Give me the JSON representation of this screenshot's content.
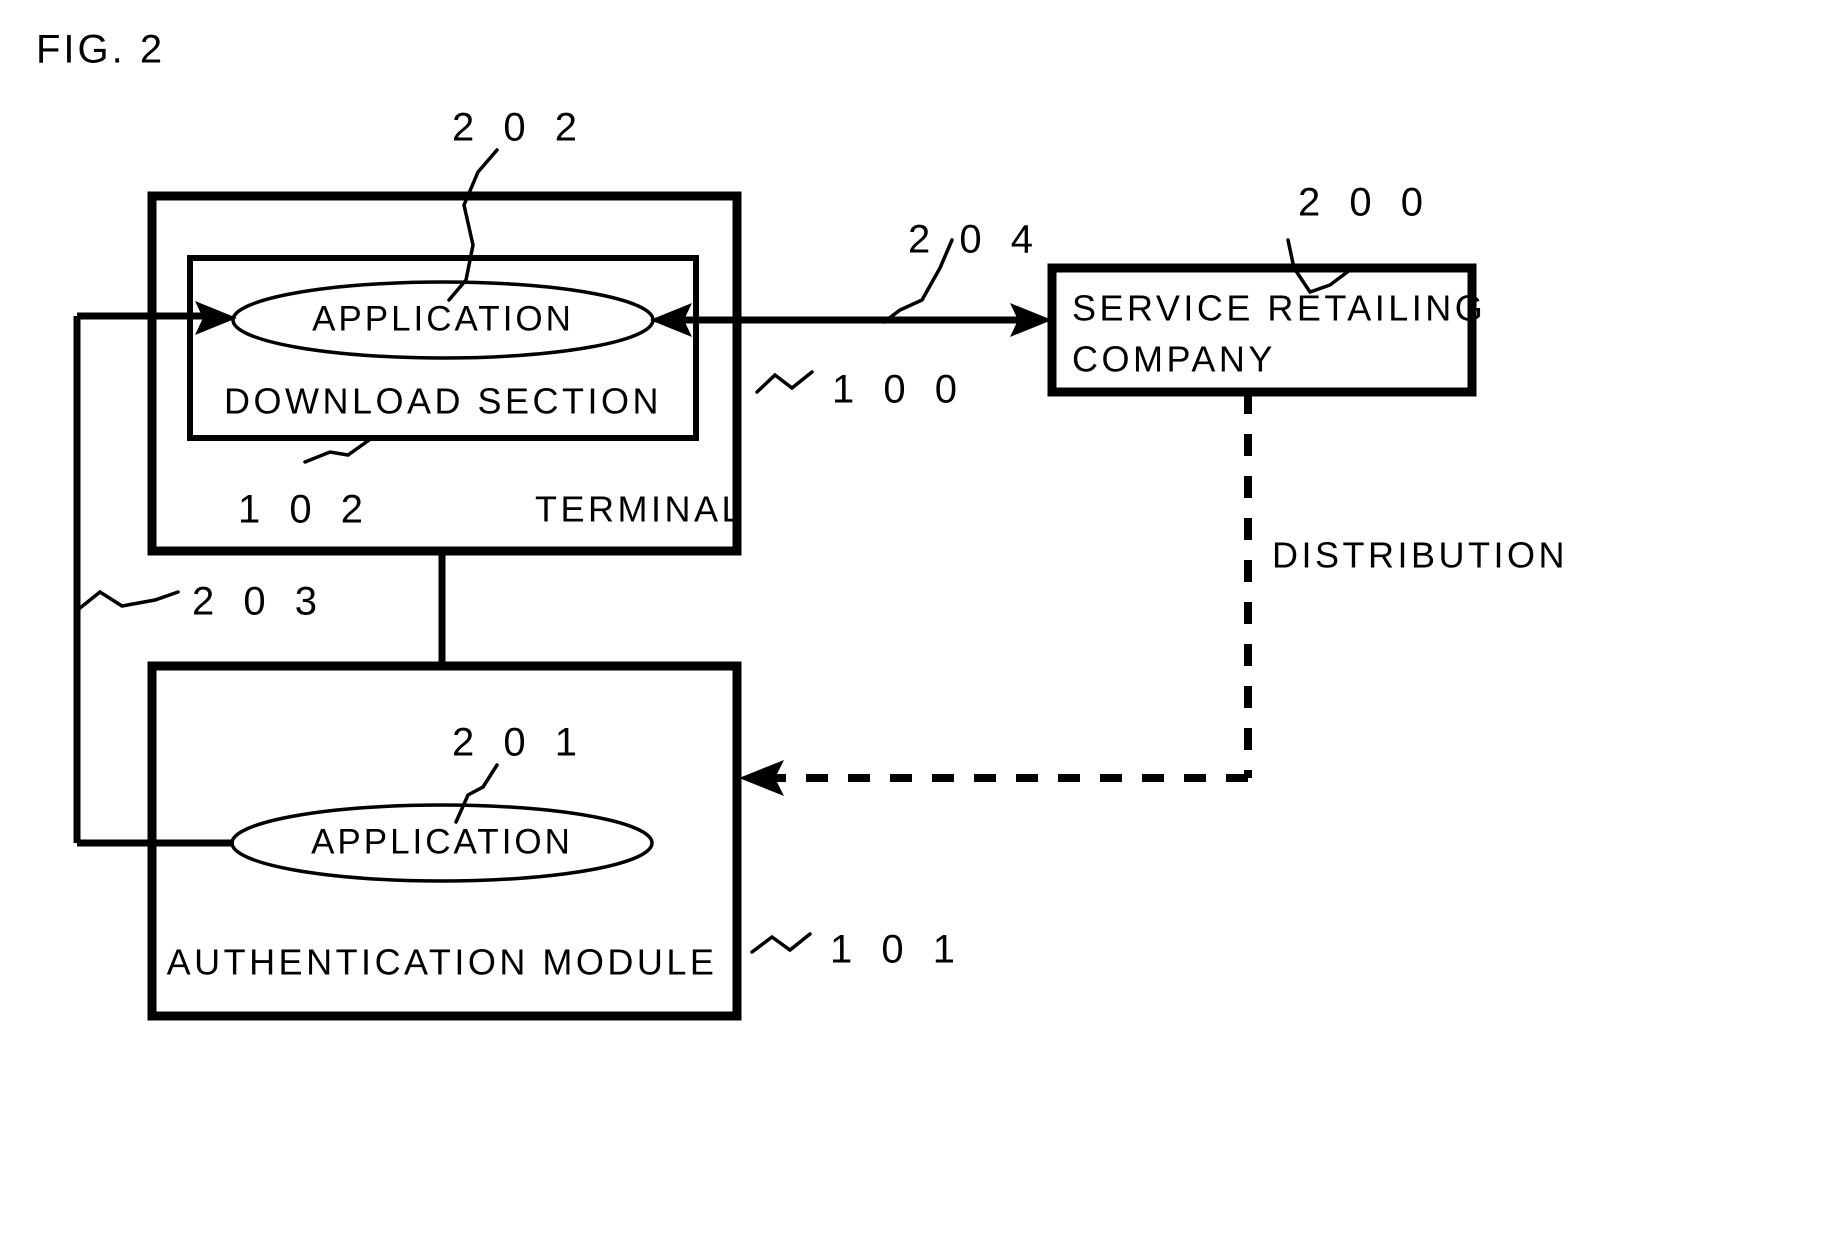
{
  "figure": {
    "title": "FIG. 2"
  },
  "nodes": {
    "terminal": {
      "label": "TERMINAL",
      "ref": "1 0 0",
      "inner_section": {
        "label": "DOWNLOAD SECTION",
        "ref": "1 0 2",
        "ellipse": {
          "label": "APPLICATION",
          "ref": "2 0 2"
        }
      }
    },
    "auth_module": {
      "label": "AUTHENTICATION MODULE",
      "ref": "1 0 1",
      "ellipse": {
        "label": "APPLICATION",
        "ref": "2 0 1"
      }
    },
    "service_company": {
      "label_line1": "SERVICE RETAILING",
      "label_line2": "COMPANY",
      "ref": "2 0 0"
    }
  },
  "connections": {
    "terminal_to_company": {
      "ref": "2 0 4"
    },
    "terminal_to_auth_left": {
      "ref": "2 0 3"
    },
    "company_to_auth": {
      "label": "DISTRIBUTION"
    }
  },
  "colors": {
    "ink": "#000000",
    "paper": "#ffffff"
  }
}
